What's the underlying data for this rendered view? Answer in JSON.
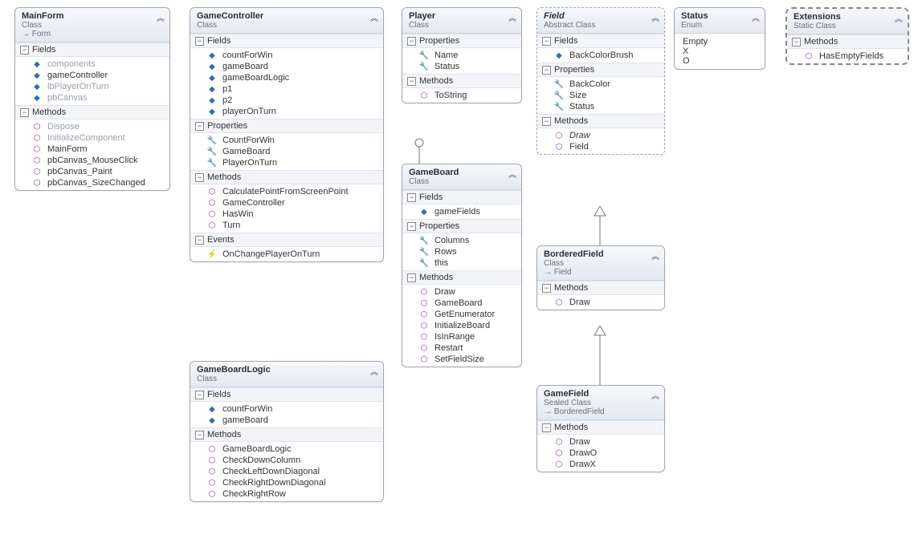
{
  "chevron": "︽",
  "inhArrow": "→",
  "mainform": {
    "title": "MainForm",
    "sub": "Class",
    "inh": "Form",
    "sec": {
      "fields": "Fields",
      "methods": "Methods"
    },
    "f": {
      "components": "components",
      "gameController": "gameController",
      "lbPlayerOnTurn": "lbPlayerOnTurn",
      "pbCanvas": "pbCanvas"
    },
    "m": {
      "dispose": "Dispose",
      "init": "InitializeComponent",
      "ctor": "MainForm",
      "mouse": "pbCanvas_MouseClick",
      "paint": "pbCanvas_Paint",
      "size": "pbCanvas_SizeChanged"
    }
  },
  "gamecontroller": {
    "title": "GameController",
    "sub": "Class",
    "sec": {
      "fields": "Fields",
      "properties": "Properties",
      "methods": "Methods",
      "events": "Events"
    },
    "f": {
      "countForWin": "countForWin",
      "gameBoard": "gameBoard",
      "gameBoardLogic": "gameBoardLogic",
      "p1": "p1",
      "p2": "p2",
      "playerOnTurn": "playerOnTurn"
    },
    "p": {
      "countForWin": "CountForWin",
      "gameBoard": "GameBoard",
      "playerOnTurn": "PlayerOnTurn"
    },
    "m": {
      "calc": "CalculatePointFromScreenPoint",
      "ctor": "GameController",
      "hasWin": "HasWin",
      "turn": "Turn"
    },
    "e": {
      "change": "OnChangePlayerOnTurn"
    }
  },
  "gameboardlogic": {
    "title": "GameBoardLogic",
    "sub": "Class",
    "sec": {
      "fields": "Fields",
      "methods": "Methods"
    },
    "f": {
      "countForWin": "countForWin",
      "gameBoard": "gameBoard"
    },
    "m": {
      "ctor": "GameBoardLogic",
      "cdc": "CheckDownColumn",
      "cld": "CheckLeftDownDiagonal",
      "crd": "CheckRightDownDiagonal",
      "crr": "CheckRightRow"
    }
  },
  "player": {
    "title": "Player",
    "sub": "Class",
    "sec": {
      "properties": "Properties",
      "methods": "Methods"
    },
    "p": {
      "name": "Name",
      "status": "Status"
    },
    "m": {
      "toString": "ToString"
    }
  },
  "gameboard": {
    "title": "GameBoard",
    "sub": "Class",
    "sec": {
      "fields": "Fields",
      "properties": "Properties",
      "methods": "Methods"
    },
    "f": {
      "gameFields": "gameFields"
    },
    "p": {
      "columns": "Columns",
      "rows": "Rows",
      "thisp": "this"
    },
    "m": {
      "draw": "Draw",
      "ctor": "GameBoard",
      "gen": "GetEnumerator",
      "init": "InitializeBoard",
      "rng": "IsInRange",
      "restart": "Restart",
      "sfs": "SetFieldSize"
    }
  },
  "field": {
    "title": "Field",
    "sub": "Abstract Class",
    "sec": {
      "fields": "Fields",
      "properties": "Properties",
      "methods": "Methods"
    },
    "f": {
      "backColorBrush": "BackColorBrush"
    },
    "p": {
      "backColor": "BackColor",
      "size": "Size",
      "status": "Status"
    },
    "m": {
      "draw": "Draw",
      "ctor": "Field"
    }
  },
  "borderedfield": {
    "title": "BorderedField",
    "sub": "Class",
    "inh": "Field",
    "sec": {
      "methods": "Methods"
    },
    "m": {
      "draw": "Draw"
    }
  },
  "gamefield": {
    "title": "GameField",
    "sub": "Sealed Class",
    "inh": "BorderedField",
    "sec": {
      "methods": "Methods"
    },
    "m": {
      "draw": "Draw",
      "drawO": "DrawO",
      "drawX": "DrawX"
    }
  },
  "status": {
    "title": "Status",
    "sub": "Enum",
    "v": {
      "empty": "Empty",
      "x": "X",
      "o": "O"
    }
  },
  "extensions": {
    "title": "Extensions",
    "sub": "Static Class",
    "sec": {
      "methods": "Methods"
    },
    "m": {
      "hasEmpty": "HasEmptyFields"
    }
  }
}
